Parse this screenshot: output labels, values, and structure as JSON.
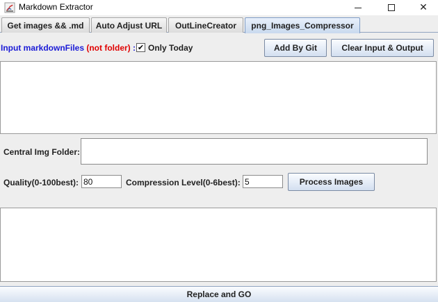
{
  "window": {
    "title": "Markdown Extractor",
    "minimize_glyph": "",
    "close_glyph": "✕"
  },
  "tabs": [
    {
      "label": "Get images && .md",
      "active": false
    },
    {
      "label": "Auto Adjust URL",
      "active": false
    },
    {
      "label": "OutLineCreator",
      "active": false
    },
    {
      "label": "png_Images_Compressor",
      "active": true
    }
  ],
  "input_row": {
    "label_main": "Input markdownFiles ",
    "label_note": "(not folder)",
    "label_colon": " :",
    "only_today_checked": true,
    "check_glyph": "✔",
    "only_today_label": "Only Today",
    "add_by_git_label": "Add By Git",
    "clear_label": "Clear Input & Output"
  },
  "central_folder": {
    "label": "Central Img Folder:",
    "value": ""
  },
  "quality": {
    "label": "Quality(0-100best):",
    "value": "80"
  },
  "compression": {
    "label": "Compression Level(0-6best):",
    "value": "5"
  },
  "process_button_label": "Process Images",
  "replace_button_label": "Replace and GO",
  "colors": {
    "label_blue": "#1a1ad6",
    "label_red": "#e00000",
    "tab_active": "#c9d9ee",
    "button_gradient_bottom": "#d3dff0"
  }
}
